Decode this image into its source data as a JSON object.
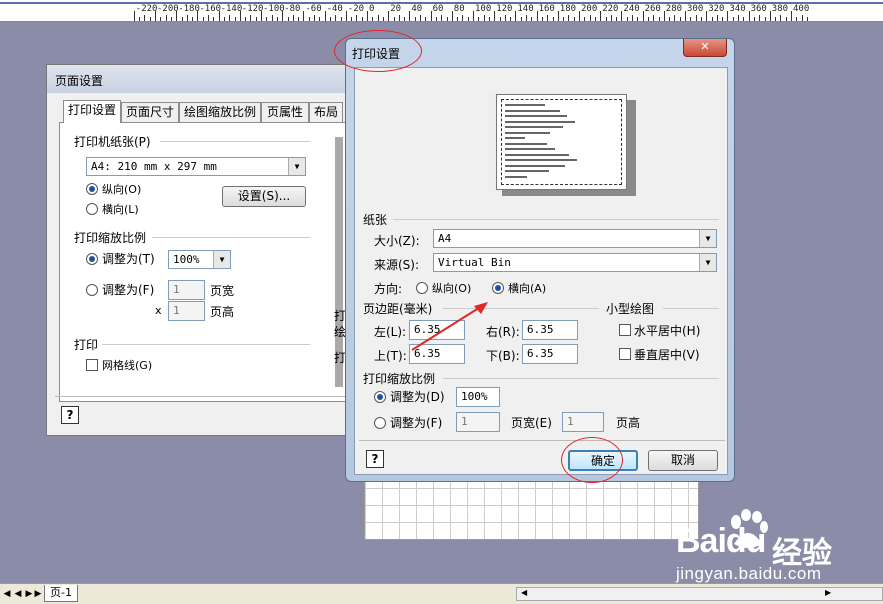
{
  "ruler": {
    "labels": [
      "-220",
      "-200",
      "-180",
      "-160",
      "-140",
      "-120",
      "-100",
      "-80",
      "-60",
      "-40",
      "-20",
      "0",
      "20",
      "40",
      "60",
      "80",
      "100",
      "120",
      "140",
      "160",
      "180",
      "200",
      "220",
      "240",
      "260",
      "280",
      "300",
      "320",
      "340",
      "360",
      "380",
      "400"
    ]
  },
  "page_setup": {
    "title": "页面设置",
    "tabs": [
      "打印设置",
      "页面尺寸",
      "绘图缩放比例",
      "页属性",
      "布局"
    ],
    "printer_paper_label": "打印机纸张(P)",
    "paper_value": "A4:  210 mm x 297 mm",
    "portrait_label": "纵向(O)",
    "landscape_label": "横向(L)",
    "setup_button": "设置(S)...",
    "print_zoom_label": "打印缩放比例",
    "adjust_to_t": "调整为(T)",
    "zoom_value": "100%",
    "adjust_to_f": "调整为(F)",
    "fit_wide_value": "1",
    "fit_wide_label": "页宽",
    "x_label": "x",
    "fit_tall_value": "1",
    "fit_tall_label": "页高",
    "print_label": "打印",
    "gridlines_label": "网格线(G)",
    "help_glyph": "?",
    "stub_texts": [
      "打",
      "绘",
      "打"
    ]
  },
  "print_setup": {
    "title": "打印设置",
    "close_glyph": "✕",
    "paper_label": "纸张",
    "size_label": "大小(Z):",
    "size_value": "A4",
    "source_label": "来源(S):",
    "source_value": "Virtual Bin",
    "orientation_label": "方向:",
    "portrait_label": "纵向(O)",
    "landscape_label": "横向(A)",
    "margins_label": "页边距(毫米)",
    "left_label": "左(L):",
    "left_value": "6.35",
    "right_label": "右(R):",
    "right_value": "6.35",
    "top_label": "上(T):",
    "top_value": "6.35",
    "bottom_label": "下(B):",
    "bottom_value": "6.35",
    "small_drawing_label": "小型绘图",
    "center_h_label": "水平居中(H)",
    "center_v_label": "垂直居中(V)",
    "print_zoom_label": "打印缩放比例",
    "adjust_to_d": "调整为(D)",
    "zoom_value": "100%",
    "adjust_to_f": "调整为(F)",
    "fit_wide_value": "1",
    "fit_wide_label": "页宽(E)",
    "fit_tall_value": "1",
    "fit_tall_label": "页高",
    "ok_button": "确定",
    "cancel_button": "取消",
    "help_glyph": "?"
  },
  "statusbar": {
    "nav_first": "◀",
    "nav_prev": "◀",
    "nav_next": "▶",
    "nav_last": "▶",
    "page_tab": "页-1",
    "scroll_left": "◀",
    "scroll_right": "▶"
  },
  "watermark": {
    "logo_text": "Baidu",
    "jingyan": "经验",
    "url": "jingyan.baidu.com"
  },
  "colors": {
    "desktop_bg": "#8b8ca8",
    "annotation_red": "#e0282a",
    "radio_dot": "#1d4fa8",
    "aero_title": "#c5d5ea"
  }
}
